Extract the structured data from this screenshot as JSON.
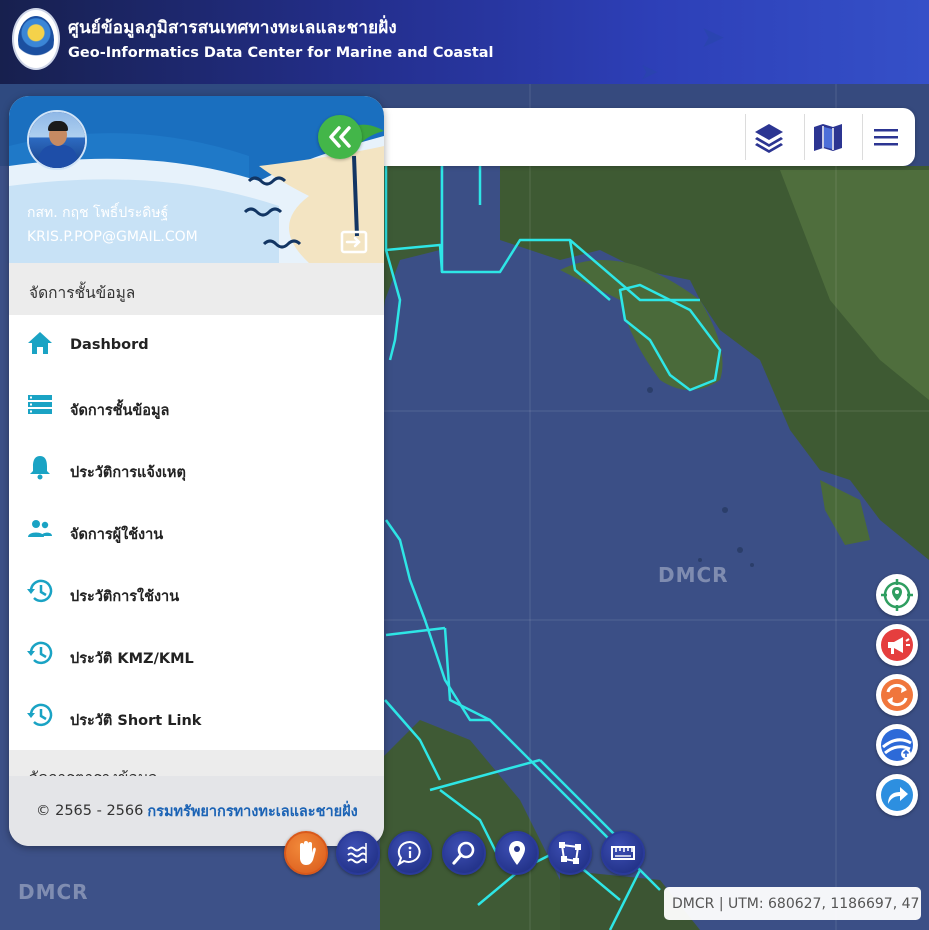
{
  "header": {
    "title_th": "ศูนย์ข้อมูลภูมิสารสนเทศทางทะเลและชายฝั่ง",
    "title_en": "Geo-Informatics Data Center for Marine and Coastal"
  },
  "toolbar": {
    "icons": [
      "layers-icon",
      "basemap-icon",
      "menu-icon"
    ]
  },
  "user": {
    "name": "กสท. กฤช โพธิ์ประดิษฐ์",
    "email": "KRIS.P.POP@GMAIL.COM"
  },
  "sidebar": {
    "section_title": "จัดการชั้นข้อมูล",
    "items": [
      {
        "label": "Dashbord",
        "icon": "home-icon"
      },
      {
        "label": "จัดการชั้นข้อมูล",
        "icon": "list-icon"
      },
      {
        "label": "ประวัติการแจ้งเหตุ",
        "icon": "bell-icon"
      },
      {
        "label": "จัดการผู้ใช้งาน",
        "icon": "users-icon"
      },
      {
        "label": "ประวัติการใช้งาน",
        "icon": "history-icon"
      },
      {
        "label": "ประวัติ KMZ/KML",
        "icon": "history-icon"
      },
      {
        "label": "ประวัติ Short Link",
        "icon": "history-icon"
      }
    ],
    "section_title_2": "จัดการตารางข้อมูล",
    "footer_years": "© 2565 - 2566",
    "footer_org": "กรมทรัพยากรทางทะเลและชายฝั่ง"
  },
  "map": {
    "watermark": "DMCR",
    "coords_text": "DMCR | UTM: 680627, 1186697, 47"
  },
  "colors": {
    "panel_head": "#1a6fbf",
    "accent_teal": "#1aa3c4",
    "boundary_line": "#2ee6e6",
    "collapse_green": "#43b649"
  }
}
